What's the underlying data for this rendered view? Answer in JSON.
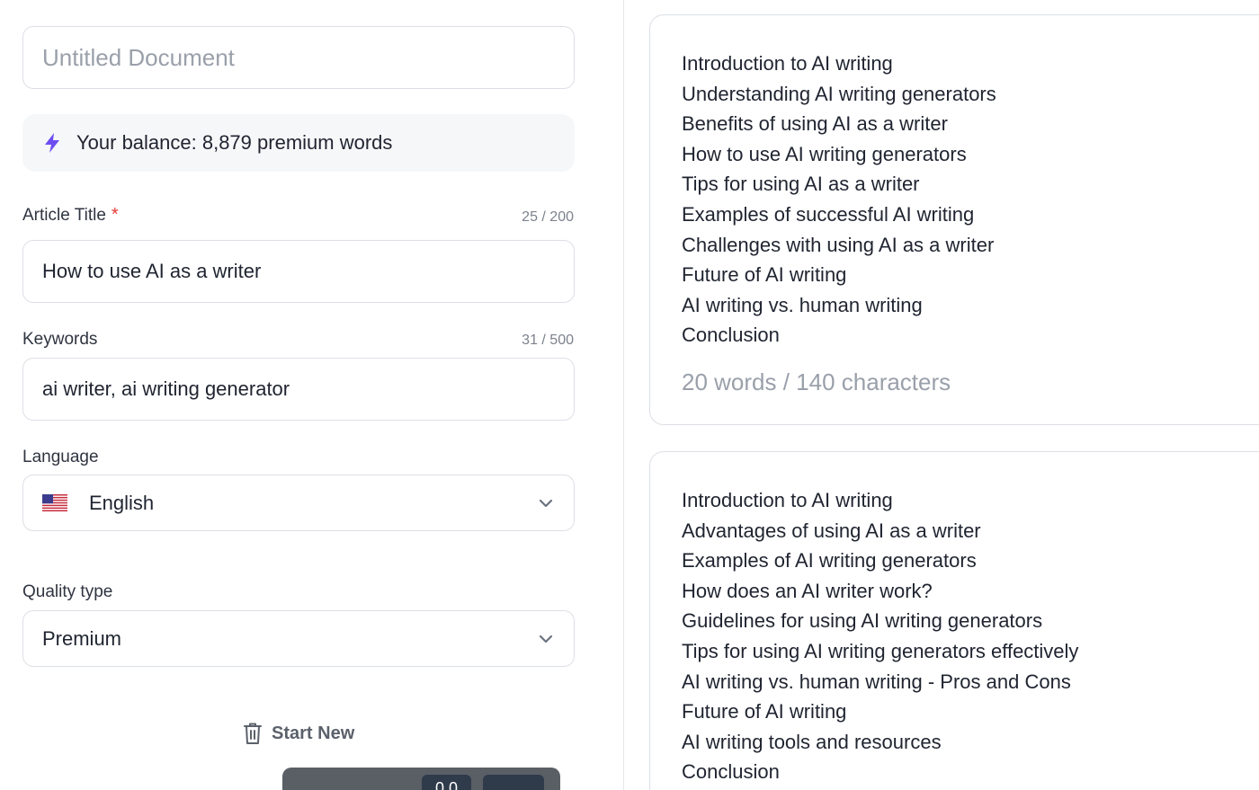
{
  "document": {
    "title_placeholder": "Untitled Document"
  },
  "balance": {
    "text": "Your balance: 8,879 premium words",
    "accent_color": "#6d4df2"
  },
  "article_title": {
    "label": "Article Title",
    "required": "*",
    "count": "25 / 200",
    "value": "How to use AI as a writer"
  },
  "keywords": {
    "label": "Keywords",
    "count": "31 / 500",
    "value": "ai writer, ai writing generator"
  },
  "language": {
    "label": "Language",
    "selected": "English",
    "flag_icon": "us-flag-icon"
  },
  "quality": {
    "label": "Quality type",
    "selected": "Premium"
  },
  "actions": {
    "start_new_label": "Start New"
  },
  "bottom_bar": {
    "pill_text": "0.0"
  },
  "outlines": [
    {
      "items": [
        "Introduction to AI writing",
        "Understanding AI writing generators",
        "Benefits of using AI as a writer",
        "How to use AI writing generators",
        "Tips for using AI as a writer",
        "Examples of successful AI writing",
        "Challenges with using AI as a writer",
        "Future of AI writing",
        "AI writing vs. human writing",
        "Conclusion"
      ],
      "stats": "20 words / 140 characters"
    },
    {
      "items": [
        "Introduction to AI writing",
        "Advantages of using AI as a writer",
        "Examples of AI writing generators",
        "How does an AI writer work?",
        "Guidelines for using AI writing generators",
        "Tips for using AI writing generators effectively",
        "AI writing vs. human writing - Pros and Cons",
        "Future of AI writing",
        "AI writing tools and resources",
        "Conclusion"
      ]
    }
  ]
}
